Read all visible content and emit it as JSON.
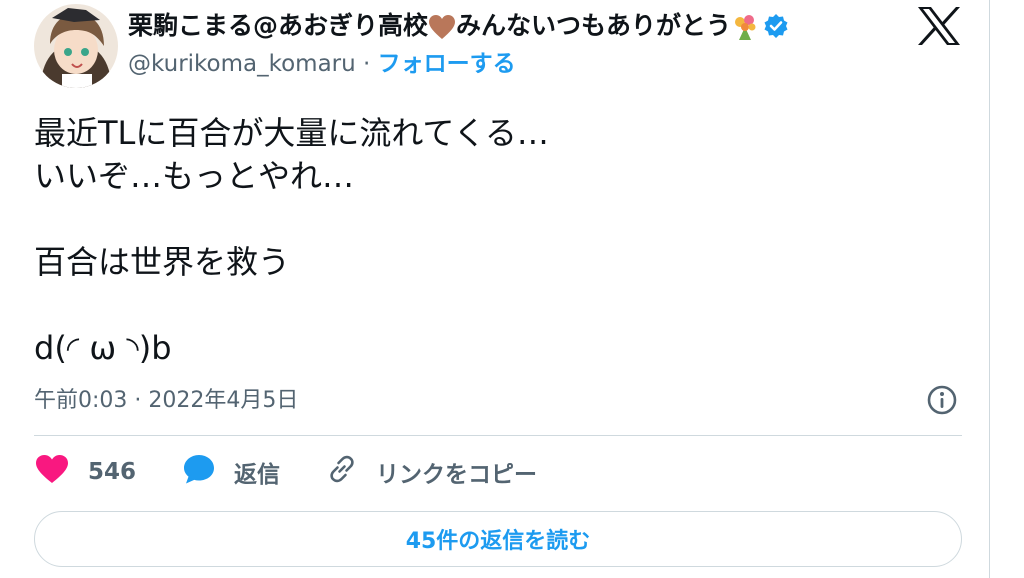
{
  "author": {
    "display_name": "栗駒こまる@あおぎり高校",
    "display_name_suffix": "みんないつもありがとう",
    "handle": "@kurikoma_komaru",
    "separator": "·",
    "follow_label": "フォローする",
    "verified": true
  },
  "tweet": {
    "lines": [
      "最近TLに百合が大量に流れてくる…",
      "いいぞ…もっとやれ…",
      "",
      "百合は世界を救う",
      "",
      "d(◜ ω ◝)b"
    ],
    "timestamp": "午前0:03 · 2022年4月5日"
  },
  "actions": {
    "like_count": "546",
    "reply_label": "返信",
    "copy_link_label": "リンクをコピー"
  },
  "read_replies_label": "45件の返信を読む",
  "colors": {
    "accent": "#1d9bf0",
    "like": "#f91880",
    "heart_emoji": "#b9775a",
    "secondary_text": "#536471",
    "border": "#cfd9de"
  },
  "icons": {
    "verified": "verified-badge-icon",
    "brand": "x-logo-icon",
    "info": "info-icon",
    "like": "heart-icon",
    "reply": "reply-bubble-icon",
    "copy_link": "link-icon",
    "emoji_heart": "brown-heart-emoji-icon",
    "emoji_bouquet": "bouquet-emoji-icon"
  }
}
